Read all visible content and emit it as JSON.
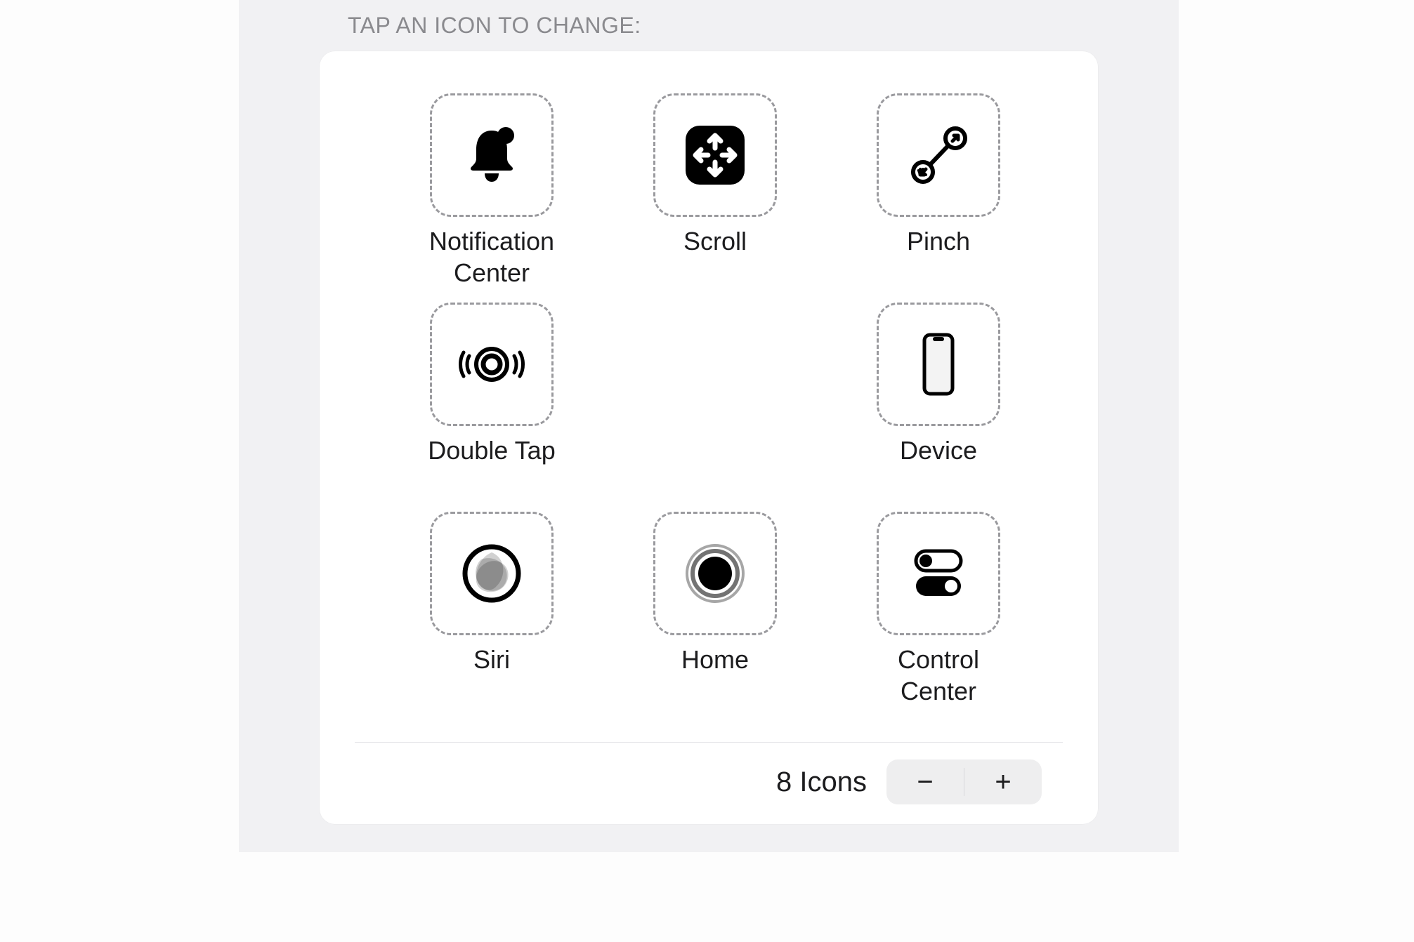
{
  "section_title": "TAP AN ICON TO CHANGE:",
  "icons": {
    "0": {
      "label": "Notification\nCenter",
      "icon": "bell-badge-icon"
    },
    "1": {
      "label": "Scroll",
      "icon": "scroll-arrows-icon"
    },
    "2": {
      "label": "Pinch",
      "icon": "pinch-icon"
    },
    "3": {
      "label": "Double Tap",
      "icon": "double-tap-icon"
    },
    "4": {
      "label": "",
      "icon": ""
    },
    "5": {
      "label": "Device",
      "icon": "device-icon"
    },
    "6": {
      "label": "Siri",
      "icon": "siri-icon"
    },
    "7": {
      "label": "Home",
      "icon": "home-button-icon"
    },
    "8": {
      "label": "Control\nCenter",
      "icon": "control-center-icon"
    }
  },
  "footer": {
    "count_label": "8 Icons",
    "minus": "−",
    "plus": "+"
  }
}
